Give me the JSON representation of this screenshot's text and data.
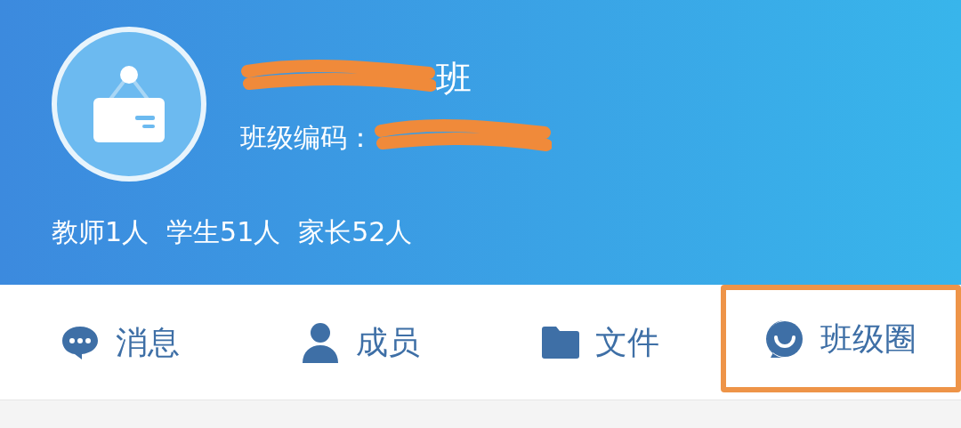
{
  "header": {
    "title": {
      "text": "班",
      "redacted": true
    },
    "code": {
      "label": "班级编码：",
      "redacted": true
    },
    "stats": [
      "教师1人",
      "学生51人",
      "家长52人"
    ]
  },
  "tabs": [
    {
      "kind": "chat",
      "label": "消息",
      "highlighted": false
    },
    {
      "kind": "person",
      "label": "成员",
      "highlighted": false
    },
    {
      "kind": "folder",
      "label": "文件",
      "highlighted": false
    },
    {
      "kind": "smile",
      "label": "班级圈",
      "highlighted": true
    }
  ]
}
